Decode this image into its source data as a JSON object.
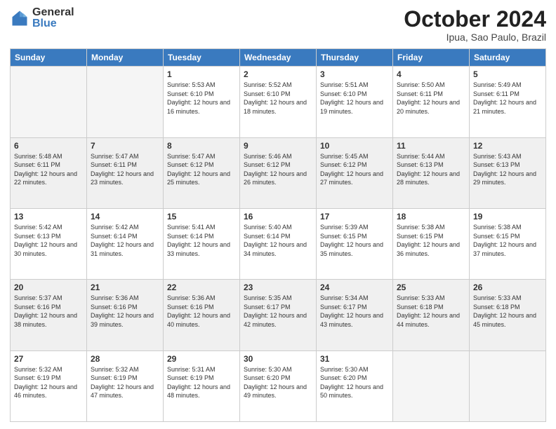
{
  "header": {
    "logo_general": "General",
    "logo_blue": "Blue",
    "month_title": "October 2024",
    "location": "Ipua, Sao Paulo, Brazil"
  },
  "days_of_week": [
    "Sunday",
    "Monday",
    "Tuesday",
    "Wednesday",
    "Thursday",
    "Friday",
    "Saturday"
  ],
  "weeks": [
    [
      {
        "day": null,
        "sunrise": null,
        "sunset": null,
        "daylight": null
      },
      {
        "day": null,
        "sunrise": null,
        "sunset": null,
        "daylight": null
      },
      {
        "day": "1",
        "sunrise": "Sunrise: 5:53 AM",
        "sunset": "Sunset: 6:10 PM",
        "daylight": "Daylight: 12 hours and 16 minutes."
      },
      {
        "day": "2",
        "sunrise": "Sunrise: 5:52 AM",
        "sunset": "Sunset: 6:10 PM",
        "daylight": "Daylight: 12 hours and 18 minutes."
      },
      {
        "day": "3",
        "sunrise": "Sunrise: 5:51 AM",
        "sunset": "Sunset: 6:10 PM",
        "daylight": "Daylight: 12 hours and 19 minutes."
      },
      {
        "day": "4",
        "sunrise": "Sunrise: 5:50 AM",
        "sunset": "Sunset: 6:11 PM",
        "daylight": "Daylight: 12 hours and 20 minutes."
      },
      {
        "day": "5",
        "sunrise": "Sunrise: 5:49 AM",
        "sunset": "Sunset: 6:11 PM",
        "daylight": "Daylight: 12 hours and 21 minutes."
      }
    ],
    [
      {
        "day": "6",
        "sunrise": "Sunrise: 5:48 AM",
        "sunset": "Sunset: 6:11 PM",
        "daylight": "Daylight: 12 hours and 22 minutes."
      },
      {
        "day": "7",
        "sunrise": "Sunrise: 5:47 AM",
        "sunset": "Sunset: 6:11 PM",
        "daylight": "Daylight: 12 hours and 23 minutes."
      },
      {
        "day": "8",
        "sunrise": "Sunrise: 5:47 AM",
        "sunset": "Sunset: 6:12 PM",
        "daylight": "Daylight: 12 hours and 25 minutes."
      },
      {
        "day": "9",
        "sunrise": "Sunrise: 5:46 AM",
        "sunset": "Sunset: 6:12 PM",
        "daylight": "Daylight: 12 hours and 26 minutes."
      },
      {
        "day": "10",
        "sunrise": "Sunrise: 5:45 AM",
        "sunset": "Sunset: 6:12 PM",
        "daylight": "Daylight: 12 hours and 27 minutes."
      },
      {
        "day": "11",
        "sunrise": "Sunrise: 5:44 AM",
        "sunset": "Sunset: 6:13 PM",
        "daylight": "Daylight: 12 hours and 28 minutes."
      },
      {
        "day": "12",
        "sunrise": "Sunrise: 5:43 AM",
        "sunset": "Sunset: 6:13 PM",
        "daylight": "Daylight: 12 hours and 29 minutes."
      }
    ],
    [
      {
        "day": "13",
        "sunrise": "Sunrise: 5:42 AM",
        "sunset": "Sunset: 6:13 PM",
        "daylight": "Daylight: 12 hours and 30 minutes."
      },
      {
        "day": "14",
        "sunrise": "Sunrise: 5:42 AM",
        "sunset": "Sunset: 6:14 PM",
        "daylight": "Daylight: 12 hours and 31 minutes."
      },
      {
        "day": "15",
        "sunrise": "Sunrise: 5:41 AM",
        "sunset": "Sunset: 6:14 PM",
        "daylight": "Daylight: 12 hours and 33 minutes."
      },
      {
        "day": "16",
        "sunrise": "Sunrise: 5:40 AM",
        "sunset": "Sunset: 6:14 PM",
        "daylight": "Daylight: 12 hours and 34 minutes."
      },
      {
        "day": "17",
        "sunrise": "Sunrise: 5:39 AM",
        "sunset": "Sunset: 6:15 PM",
        "daylight": "Daylight: 12 hours and 35 minutes."
      },
      {
        "day": "18",
        "sunrise": "Sunrise: 5:38 AM",
        "sunset": "Sunset: 6:15 PM",
        "daylight": "Daylight: 12 hours and 36 minutes."
      },
      {
        "day": "19",
        "sunrise": "Sunrise: 5:38 AM",
        "sunset": "Sunset: 6:15 PM",
        "daylight": "Daylight: 12 hours and 37 minutes."
      }
    ],
    [
      {
        "day": "20",
        "sunrise": "Sunrise: 5:37 AM",
        "sunset": "Sunset: 6:16 PM",
        "daylight": "Daylight: 12 hours and 38 minutes."
      },
      {
        "day": "21",
        "sunrise": "Sunrise: 5:36 AM",
        "sunset": "Sunset: 6:16 PM",
        "daylight": "Daylight: 12 hours and 39 minutes."
      },
      {
        "day": "22",
        "sunrise": "Sunrise: 5:36 AM",
        "sunset": "Sunset: 6:16 PM",
        "daylight": "Daylight: 12 hours and 40 minutes."
      },
      {
        "day": "23",
        "sunrise": "Sunrise: 5:35 AM",
        "sunset": "Sunset: 6:17 PM",
        "daylight": "Daylight: 12 hours and 42 minutes."
      },
      {
        "day": "24",
        "sunrise": "Sunrise: 5:34 AM",
        "sunset": "Sunset: 6:17 PM",
        "daylight": "Daylight: 12 hours and 43 minutes."
      },
      {
        "day": "25",
        "sunrise": "Sunrise: 5:33 AM",
        "sunset": "Sunset: 6:18 PM",
        "daylight": "Daylight: 12 hours and 44 minutes."
      },
      {
        "day": "26",
        "sunrise": "Sunrise: 5:33 AM",
        "sunset": "Sunset: 6:18 PM",
        "daylight": "Daylight: 12 hours and 45 minutes."
      }
    ],
    [
      {
        "day": "27",
        "sunrise": "Sunrise: 5:32 AM",
        "sunset": "Sunset: 6:19 PM",
        "daylight": "Daylight: 12 hours and 46 minutes."
      },
      {
        "day": "28",
        "sunrise": "Sunrise: 5:32 AM",
        "sunset": "Sunset: 6:19 PM",
        "daylight": "Daylight: 12 hours and 47 minutes."
      },
      {
        "day": "29",
        "sunrise": "Sunrise: 5:31 AM",
        "sunset": "Sunset: 6:19 PM",
        "daylight": "Daylight: 12 hours and 48 minutes."
      },
      {
        "day": "30",
        "sunrise": "Sunrise: 5:30 AM",
        "sunset": "Sunset: 6:20 PM",
        "daylight": "Daylight: 12 hours and 49 minutes."
      },
      {
        "day": "31",
        "sunrise": "Sunrise: 5:30 AM",
        "sunset": "Sunset: 6:20 PM",
        "daylight": "Daylight: 12 hours and 50 minutes."
      },
      {
        "day": null,
        "sunrise": null,
        "sunset": null,
        "daylight": null
      },
      {
        "day": null,
        "sunrise": null,
        "sunset": null,
        "daylight": null
      }
    ]
  ]
}
